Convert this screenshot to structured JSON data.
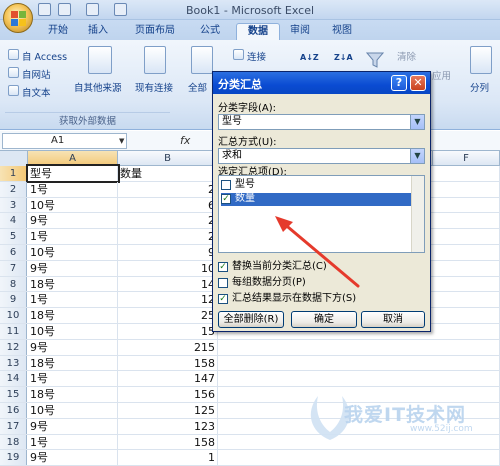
{
  "window": {
    "title": "Book1 - Microsoft Excel"
  },
  "tabs": [
    {
      "label": "开始",
      "active": false
    },
    {
      "label": "插入",
      "active": false
    },
    {
      "label": "页面布局",
      "active": false
    },
    {
      "label": "公式",
      "active": false
    },
    {
      "label": "数据",
      "active": true
    },
    {
      "label": "审阅",
      "active": false
    },
    {
      "label": "视图",
      "active": false
    }
  ],
  "ribbon": {
    "access": "自 Access",
    "web": "自网站",
    "text": "自文本",
    "other_sources": "自其他来源",
    "existing": "现有连接",
    "refresh_all": "全部",
    "connections": "连接",
    "clear": "清除",
    "reapply": "应用",
    "text_to_columns": "分列",
    "group_label": "获取外部数据",
    "sort_az": "A↓Z",
    "sort_za": "Z↓A"
  },
  "formula_bar": {
    "name_box": "A1",
    "fx": "fx"
  },
  "grid": {
    "columns": [
      "A",
      "B",
      "F"
    ],
    "rows": [
      {
        "n": "1",
        "a": "型号",
        "b": "数量"
      },
      {
        "n": "2",
        "a": "1号",
        "b": "2"
      },
      {
        "n": "3",
        "a": "10号",
        "b": "6"
      },
      {
        "n": "4",
        "a": "9号",
        "b": "2"
      },
      {
        "n": "5",
        "a": "1号",
        "b": "2"
      },
      {
        "n": "6",
        "a": "10号",
        "b": "9"
      },
      {
        "n": "7",
        "a": "9号",
        "b": "10"
      },
      {
        "n": "8",
        "a": "18号",
        "b": "14"
      },
      {
        "n": "9",
        "a": "1号",
        "b": "12"
      },
      {
        "n": "10",
        "a": "18号",
        "b": "25"
      },
      {
        "n": "11",
        "a": "10号",
        "b": "15"
      },
      {
        "n": "12",
        "a": "9号",
        "b": "215"
      },
      {
        "n": "13",
        "a": "18号",
        "b": "158"
      },
      {
        "n": "14",
        "a": "1号",
        "b": "147"
      },
      {
        "n": "15",
        "a": "18号",
        "b": "156"
      },
      {
        "n": "16",
        "a": "10号",
        "b": "125"
      },
      {
        "n": "17",
        "a": "9号",
        "b": "123"
      },
      {
        "n": "18",
        "a": "1号",
        "b": "158"
      },
      {
        "n": "19",
        "a": "9号",
        "b": "1"
      }
    ]
  },
  "dialog": {
    "title": "分类汇总",
    "group_by_label": "分类字段(A):",
    "group_by_value": "型号",
    "function_label": "汇总方式(U):",
    "function_value": "求和",
    "items_label": "选定汇总项(D):",
    "items": [
      {
        "label": "型号",
        "checked": false,
        "selected": false
      },
      {
        "label": "数量",
        "checked": true,
        "selected": true
      }
    ],
    "options": [
      {
        "label": "替换当前分类汇总(C)",
        "checked": true
      },
      {
        "label": "每组数据分页(P)",
        "checked": false
      },
      {
        "label": "汇总结果显示在数据下方(S)",
        "checked": true
      }
    ],
    "buttons": {
      "remove_all": "全部删除(R)",
      "ok": "确定",
      "cancel": "取消"
    }
  },
  "watermark": {
    "text": "我爱IT技术网",
    "url": "www.52ij.com"
  }
}
